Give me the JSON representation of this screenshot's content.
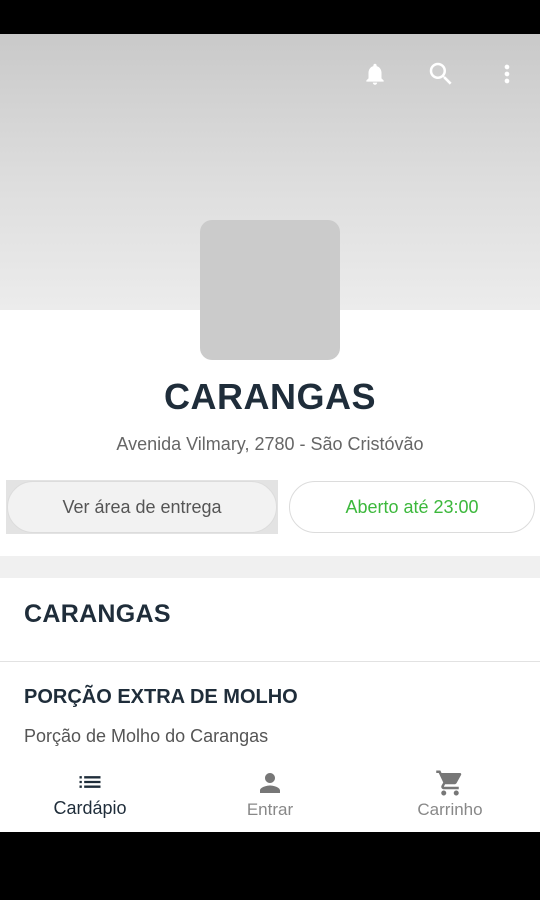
{
  "header": {
    "actions": [
      {
        "icon": "bell-icon"
      },
      {
        "icon": "search-icon"
      },
      {
        "icon": "more-vert-icon"
      }
    ]
  },
  "store": {
    "name": "CARANGAS",
    "address": "Avenida Vilmary, 2780 - São Cristóvão",
    "delivery_area_label": "Ver área de entrega",
    "open_status": "Aberto até 23:00",
    "open_status_color": "#3cb83c"
  },
  "menu": {
    "section_title": "CARANGAS",
    "items": [
      {
        "name": "PORÇÃO EXTRA DE MOLHO",
        "description": "Porção de Molho do Carangas"
      }
    ]
  },
  "bottom_nav": {
    "items": [
      {
        "label": "Cardápio",
        "icon": "menu-list-icon",
        "active": true
      },
      {
        "label": "Entrar",
        "icon": "person-icon",
        "active": false
      },
      {
        "label": "Carrinho",
        "icon": "cart-icon",
        "active": false
      }
    ]
  },
  "colors": {
    "primary_text": "#1f2d3a",
    "accent_green": "#3cb83c"
  }
}
